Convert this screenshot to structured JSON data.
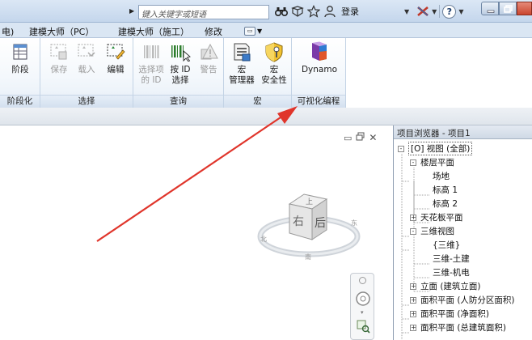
{
  "titlebar": {
    "search_placeholder": "键入关键字或短语",
    "login_label": "登录",
    "help_label": "?"
  },
  "tabs": [
    "电)",
    "建模大师（PC）",
    "建模大师（施工）",
    "修改"
  ],
  "ribbon": {
    "panels": [
      {
        "title": "阶段化",
        "buttons": [
          {
            "label": "阶段",
            "enabled": true
          }
        ]
      },
      {
        "title": "选择",
        "buttons": [
          {
            "label": "保存",
            "enabled": false
          },
          {
            "label": "载入",
            "enabled": false
          },
          {
            "label": "编辑",
            "enabled": true
          }
        ]
      },
      {
        "title": "查询",
        "buttons": [
          {
            "label": "选择项\n的 ID",
            "enabled": false
          },
          {
            "label": "按 ID\n选择",
            "enabled": true
          },
          {
            "label": "警告",
            "enabled": false
          }
        ]
      },
      {
        "title": "宏",
        "buttons": [
          {
            "label": "宏\n管理器",
            "enabled": true
          },
          {
            "label": "宏\n安全性",
            "enabled": true
          }
        ]
      },
      {
        "title": "可视化编程",
        "buttons": [
          {
            "label": "Dynamo",
            "enabled": true
          }
        ]
      }
    ]
  },
  "viewcube": {
    "face_top": "上",
    "face_front": "后",
    "face_left": "右",
    "compass": [
      "北",
      "东",
      "南"
    ]
  },
  "browser": {
    "title": "项目浏览器 - 项目1",
    "tree": [
      {
        "label": "[O] 视图 (全部)",
        "level": 0,
        "toggle": "-"
      },
      {
        "label": "楼层平面",
        "level": 1,
        "toggle": "-"
      },
      {
        "label": "场地",
        "level": 2,
        "toggle": ""
      },
      {
        "label": "标高 1",
        "level": 2,
        "toggle": ""
      },
      {
        "label": "标高 2",
        "level": 2,
        "toggle": ""
      },
      {
        "label": "天花板平面",
        "level": 1,
        "toggle": "+"
      },
      {
        "label": "三维视图",
        "level": 1,
        "toggle": "-"
      },
      {
        "label": "{三维}",
        "level": 2,
        "toggle": ""
      },
      {
        "label": "三维-土建",
        "level": 2,
        "toggle": ""
      },
      {
        "label": "三维-机电",
        "level": 2,
        "toggle": ""
      },
      {
        "label": "立面 (建筑立面)",
        "level": 1,
        "toggle": "+"
      },
      {
        "label": "面积平面 (人防分区面积)",
        "level": 1,
        "toggle": "+"
      },
      {
        "label": "面积平面 (净面积)",
        "level": 1,
        "toggle": "+"
      },
      {
        "label": "面积平面 (总建筑面积)",
        "level": 1,
        "toggle": "+"
      }
    ]
  },
  "colors": {
    "annotation_arrow": "#e0352b",
    "ribbon_accent": "#dae6f3"
  }
}
